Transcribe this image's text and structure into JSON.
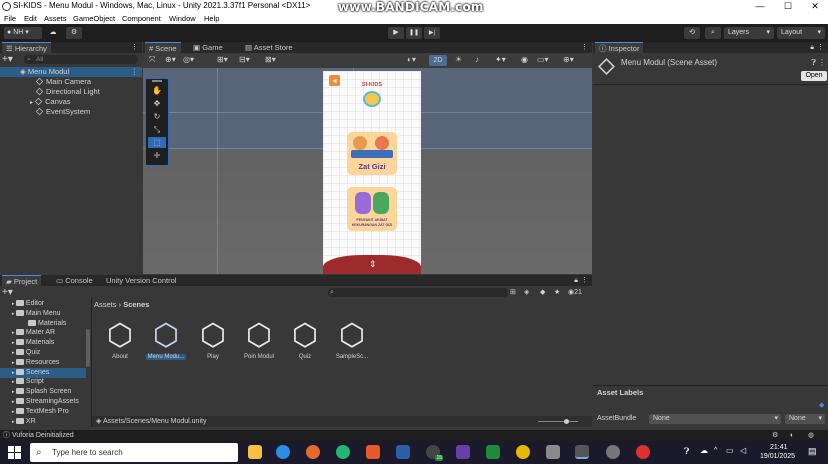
{
  "window": {
    "title": "SI-KIDS - Menu Modul - Windows, Mac, Linux - Unity 2021.3.37f1 Personal <DX11>",
    "watermark": "www.BANDICAM.com",
    "controls": {
      "minimize": "—",
      "maximize": "☐",
      "close": "✕"
    }
  },
  "menu": [
    "File",
    "Edit",
    "Assets",
    "GameObject",
    "Component",
    "Window",
    "Help"
  ],
  "toolbar": {
    "account": "NH",
    "play": "▶",
    "pause": "❚❚",
    "step": "▶|",
    "layers": "Layers",
    "layout": "Layout"
  },
  "hierarchy": {
    "tab": "Hierarchy",
    "search_placeholder": "All",
    "scene": "Menu Modul",
    "items": [
      "Main Camera",
      "Directional Light",
      "Canvas",
      "EventSystem"
    ]
  },
  "scene": {
    "tabs": [
      "Scene",
      "Game",
      "Asset Store"
    ],
    "mode_2d": "2D",
    "phone": {
      "logo": "SI-KIDS",
      "card1": "Zat Gizi",
      "card2_line1": "PENYAKIT AKIBAT",
      "card2_line2": "KEKURANGAN ZAT GIZI"
    }
  },
  "inspector": {
    "tab": "Inspector",
    "title": "Menu Modul (Scene Asset)",
    "open_button": "Open",
    "asset_labels": "Asset Labels",
    "asset_bundle_label": "AssetBundle",
    "asset_bundle_value": "None",
    "asset_bundle_variant": "None"
  },
  "project": {
    "tabs": [
      "Project",
      "Console",
      "Unity Version Control"
    ],
    "breadcrumb": [
      "Assets",
      "Scenes"
    ],
    "count": "21",
    "folders": [
      {
        "name": "Editor",
        "indent": 1
      },
      {
        "name": "Main Menu",
        "indent": 1
      },
      {
        "name": "Materials",
        "indent": 2
      },
      {
        "name": "Mater AR",
        "indent": 1
      },
      {
        "name": "Materials",
        "indent": 1
      },
      {
        "name": "Quiz",
        "indent": 1
      },
      {
        "name": "Resources",
        "indent": 1
      },
      {
        "name": "Scenes",
        "indent": 1
      },
      {
        "name": "Script",
        "indent": 1
      },
      {
        "name": "Splash Screen",
        "indent": 1
      },
      {
        "name": "StreamingAssets",
        "indent": 1
      },
      {
        "name": "TextMesh Pro",
        "indent": 1
      },
      {
        "name": "XR",
        "indent": 1
      }
    ],
    "assets": [
      "About",
      "Menu Modu...",
      "Play",
      "Poin Modul",
      "Quiz",
      "SampleSc..."
    ],
    "selected_path": "Assets/Scenes/Menu Modul.unity"
  },
  "status": {
    "message": "Vuforia Deinitialized"
  },
  "taskbar": {
    "search_placeholder": "Type here to search",
    "badge": "15",
    "time": "21:41",
    "date": "19/01/2025"
  },
  "colors": {
    "selection": "#2c5d87",
    "accent": "#4a8ae0",
    "card": "#fcd59a",
    "phone_bottom": "#9e2b2b"
  }
}
